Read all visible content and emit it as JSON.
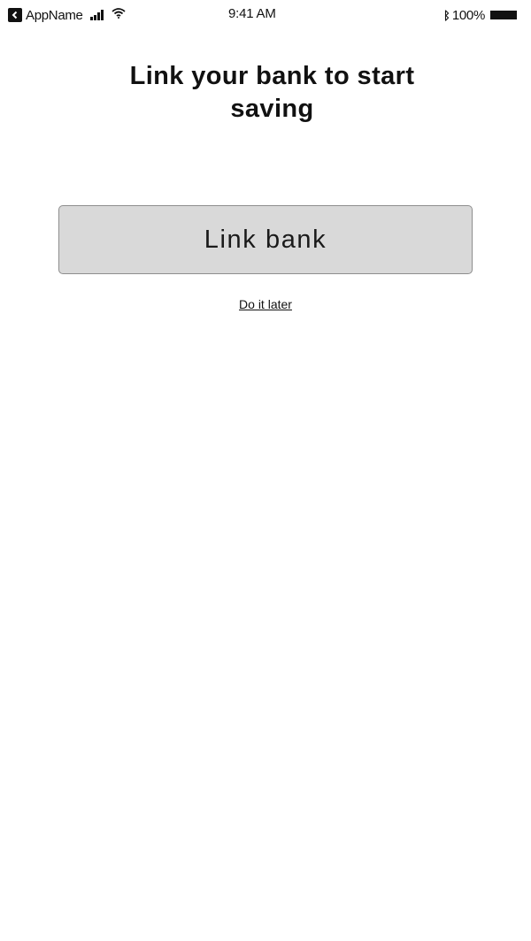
{
  "status_bar": {
    "app_name": "AppName",
    "time": "9:41 AM",
    "battery_percent": "100%",
    "icons": [
      "back-icon",
      "signal-icon",
      "wifi-icon",
      "bluetooth-icon",
      "battery-icon"
    ]
  },
  "main": {
    "title": "Link your bank to start saving",
    "link_bank_label": "Link bank",
    "do_it_later_label": "Do it later"
  },
  "colors": {
    "button_background": "#d9d9d9",
    "button_border": "#8e8e8e",
    "text": "#111111",
    "background": "#ffffff"
  }
}
